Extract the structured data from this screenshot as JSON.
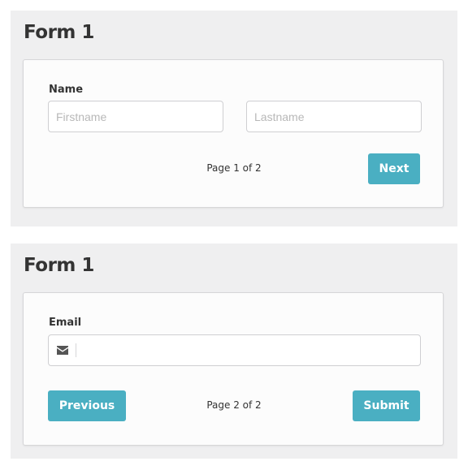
{
  "colors": {
    "accent": "#4aafc2",
    "panel_bg": "#efeff0",
    "card_bg": "#fcfcfc",
    "text": "#333333"
  },
  "page1": {
    "title": "Form 1",
    "name_label": "Name",
    "firstname": {
      "value": "",
      "placeholder": "Firstname"
    },
    "lastname": {
      "value": "",
      "placeholder": "Lastname"
    },
    "page_indicator": "Page 1 of 2",
    "next_label": "Next"
  },
  "page2": {
    "title": "Form 1",
    "email_label": "Email",
    "email_icon": "envelope-icon",
    "email": {
      "value": "",
      "placeholder": ""
    },
    "page_indicator": "Page 2 of 2",
    "previous_label": "Previous",
    "submit_label": "Submit"
  }
}
